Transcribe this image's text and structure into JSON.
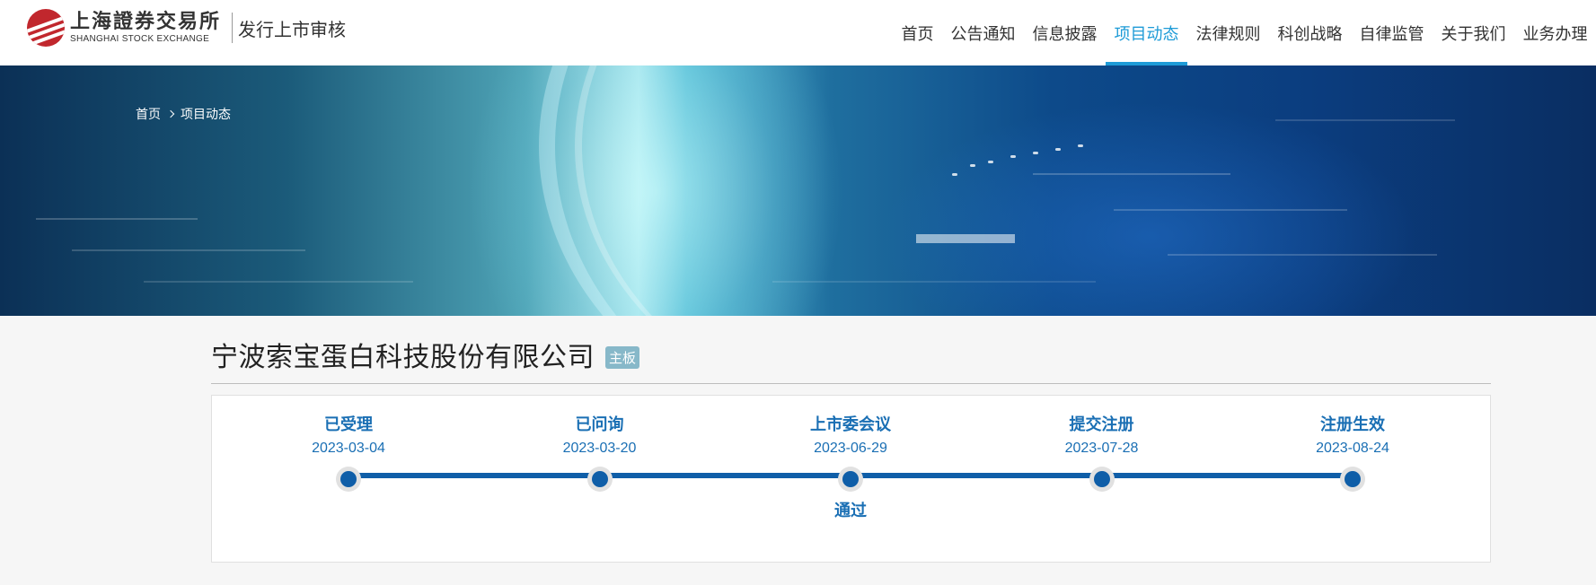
{
  "header": {
    "logo_cn": "上海證券交易所",
    "logo_en": "SHANGHAI STOCK EXCHANGE",
    "subtitle": "发行上市审核",
    "nav": [
      {
        "label": "首页"
      },
      {
        "label": "公告通知"
      },
      {
        "label": "信息披露"
      },
      {
        "label": "项目动态",
        "active": true
      },
      {
        "label": "法律规则"
      },
      {
        "label": "科创战略"
      },
      {
        "label": "自律监管"
      },
      {
        "label": "关于我们"
      },
      {
        "label": "业务办理"
      }
    ]
  },
  "breadcrumb": {
    "home": "首页",
    "current": "项目动态"
  },
  "company": {
    "name": "宁波索宝蛋白科技股份有限公司",
    "board": "主板"
  },
  "timeline": {
    "steps": [
      {
        "name": "已受理",
        "date": "2023-03-04",
        "result": ""
      },
      {
        "name": "已问询",
        "date": "2023-03-20",
        "result": ""
      },
      {
        "name": "上市委会议",
        "date": "2023-06-29",
        "result": "通过"
      },
      {
        "name": "提交注册",
        "date": "2023-07-28",
        "result": ""
      },
      {
        "name": "注册生效",
        "date": "2023-08-24",
        "result": ""
      }
    ]
  },
  "colors": {
    "accent": "#1e9bd7",
    "timeline": "#0f5ea8",
    "badge": "#87b8c9",
    "logo_red": "#c1272d"
  }
}
